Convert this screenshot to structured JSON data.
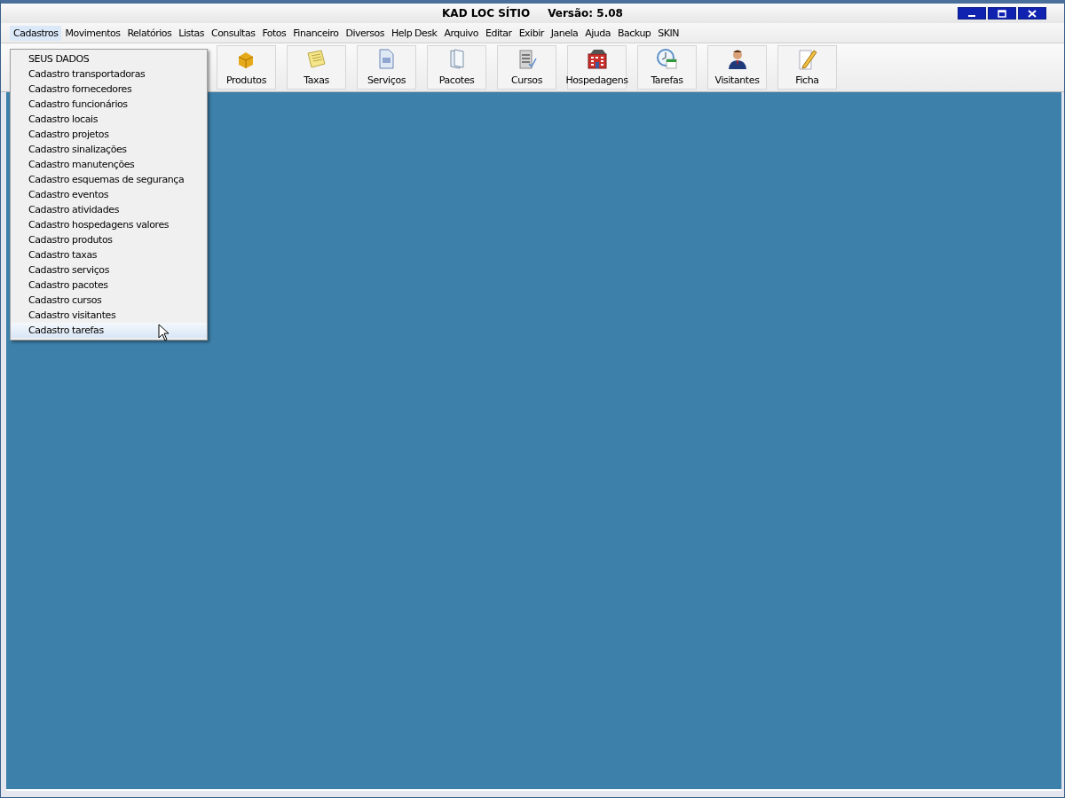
{
  "window": {
    "title": "KAD LOC SÍTIO",
    "version": "Versão: 5.08"
  },
  "menu_bar": [
    {
      "label": "Cadastros",
      "selected": true
    },
    {
      "label": "Movimentos",
      "selected": false
    },
    {
      "label": "Relatórios",
      "selected": false
    },
    {
      "label": "Listas",
      "selected": false
    },
    {
      "label": "Consultas",
      "selected": false
    },
    {
      "label": "Fotos",
      "selected": false
    },
    {
      "label": "Financeiro",
      "selected": false
    },
    {
      "label": "Diversos",
      "selected": false
    },
    {
      "label": "Help Desk",
      "selected": false
    },
    {
      "label": "Arquivo",
      "selected": false
    },
    {
      "label": "Editar",
      "selected": false
    },
    {
      "label": "Exibir",
      "selected": false
    },
    {
      "label": "Janela",
      "selected": false
    },
    {
      "label": "Ajuda",
      "selected": false
    },
    {
      "label": "Backup",
      "selected": false
    },
    {
      "label": "SKIN",
      "selected": false
    }
  ],
  "toolbar": [
    {
      "label": "Produtos",
      "kind": "box"
    },
    {
      "label": "Taxas",
      "kind": "note"
    },
    {
      "label": "Serviços",
      "kind": "document"
    },
    {
      "label": "Pacotes",
      "kind": "pages"
    },
    {
      "label": "Cursos",
      "kind": "list"
    },
    {
      "label": "Hospedagens",
      "kind": "building"
    },
    {
      "label": "Tarefas",
      "kind": "clock"
    },
    {
      "label": "Visitantes",
      "kind": "person"
    },
    {
      "label": "Ficha",
      "kind": "pencil"
    }
  ],
  "dropdown": [
    {
      "label": "SEUS DADOS",
      "selected": false
    },
    {
      "label": "Cadastro transportadoras",
      "selected": false
    },
    {
      "label": "Cadastro fornecedores",
      "selected": false
    },
    {
      "label": "Cadastro funcionários",
      "selected": false
    },
    {
      "label": "Cadastro locais",
      "selected": false
    },
    {
      "label": "Cadastro projetos",
      "selected": false
    },
    {
      "label": "Cadastro sinalizações",
      "selected": false
    },
    {
      "label": "Cadastro manutenções",
      "selected": false
    },
    {
      "label": "Cadastro esquemas de segurança",
      "selected": false
    },
    {
      "label": "Cadastro eventos",
      "selected": false
    },
    {
      "label": "Cadastro atividades",
      "selected": false
    },
    {
      "label": "Cadastro hospedagens valores",
      "selected": false
    },
    {
      "label": "Cadastro produtos",
      "selected": false
    },
    {
      "label": "Cadastro taxas",
      "selected": false
    },
    {
      "label": "Cadastro serviços",
      "selected": false
    },
    {
      "label": "Cadastro pacotes",
      "selected": false
    },
    {
      "label": "Cadastro cursos",
      "selected": false
    },
    {
      "label": "Cadastro visitantes",
      "selected": false
    },
    {
      "label": "Cadastro tarefas",
      "selected": true
    }
  ]
}
